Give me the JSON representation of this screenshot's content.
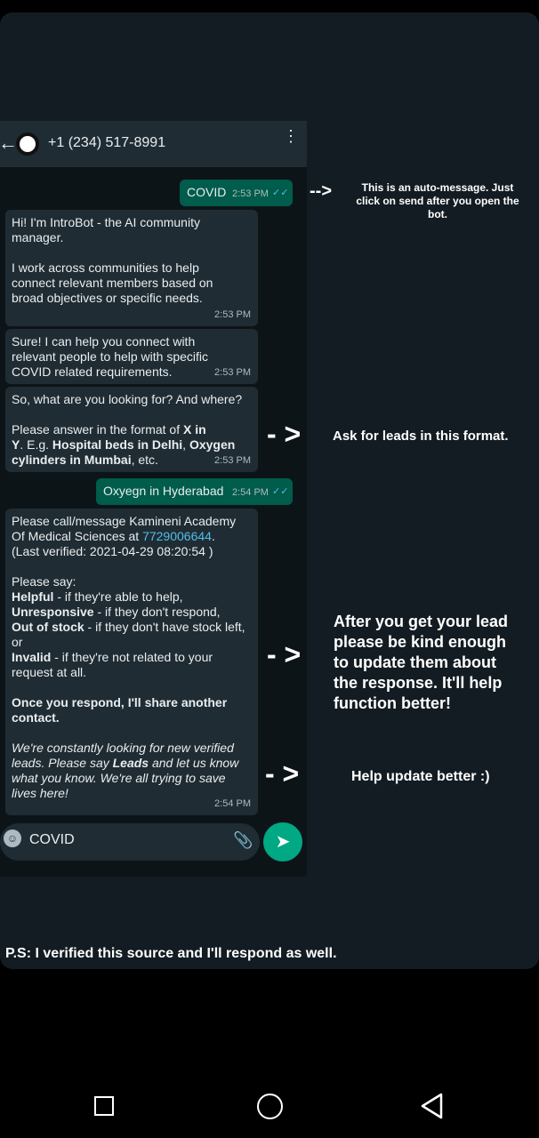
{
  "header": {
    "back": "←",
    "contact": "+1 (234) 517-8991",
    "menu": "⋮"
  },
  "messages": {
    "covid_out": {
      "text": "COVID",
      "time": "2:53 PM",
      "status": "✓✓"
    },
    "intro1": {
      "line1": "Hi! I'm IntroBot - the AI community",
      "line2": "manager.",
      "line3": "I work across communities to help",
      "line4": "connect relevant members based on",
      "line5": "broad objectives or specific needs.",
      "time": "2:53 PM"
    },
    "intro2": {
      "line1": "Sure! I can help you connect with",
      "line2": "relevant people to help with specific",
      "line3": "COVID related requirements.",
      "time": "2:53 PM"
    },
    "intro3": {
      "line1": "So, what are you looking for? And where?",
      "line2a": "Please answer in the format of ",
      "line2b": "X in",
      "line3a": "Y",
      "line3b": ". E.g. ",
      "line3c": "Hospital beds in Delhi",
      "line3d": ", ",
      "line3e": "Oxygen",
      "line4a": "cylinders in Mumbai",
      "line4b": ", etc.",
      "time": "2:53 PM"
    },
    "oxygen_out": {
      "text": "Oxyegn in Hyderabad",
      "time": "2:54 PM",
      "status": "✓✓"
    },
    "lead": {
      "line1": "Please call/message Kamineni Academy",
      "line2a": "Of Medical Sciences at ",
      "phone": "7729006644",
      "line2b": ".",
      "line3": "(Last verified: 2021-04-29 08:20:54 )",
      "say": "Please say:",
      "h1": "Helpful",
      "h1d": " - if they're able to help,",
      "h2": "Unresponsive",
      "h2d": " - if they don't respond,",
      "h3": "Out of stock",
      "h3d": " - if they don't have stock left,",
      "or": "or",
      "h4": "Invalid",
      "h4d": " - if they're not related to your",
      "h4e": "request at all.",
      "once1": "Once you respond, I'll share another",
      "once2": "contact.",
      "i1": "We're constantly looking for new verified",
      "i2a": "leads. Please say ",
      "i2b": "Leads",
      "i2c": " and let us know",
      "i3": "what you know. We're all trying to save",
      "i4": "lives here!",
      "time": "2:54 PM"
    }
  },
  "input": {
    "value": "COVID",
    "emoji": "☺",
    "clip": "📎",
    "send": "➤"
  },
  "annotations": {
    "a1_line1": "This is an auto-message. Just",
    "a1_line2": "click on send after you open the",
    "a1_line3": "bot.",
    "a2": "Ask for leads in this format.",
    "a3_line1": "After you get your lead",
    "a3_line2": "please be kind enough",
    "a3_line3": "to update them about",
    "a3_line4": "the response. It'll help",
    "a3_line5": "function better!",
    "a4": "Help update better :)",
    "ps": "P.S: I verified this source and I'll respond as well."
  },
  "arrows": {
    "small": "-->",
    "big": "- >"
  }
}
